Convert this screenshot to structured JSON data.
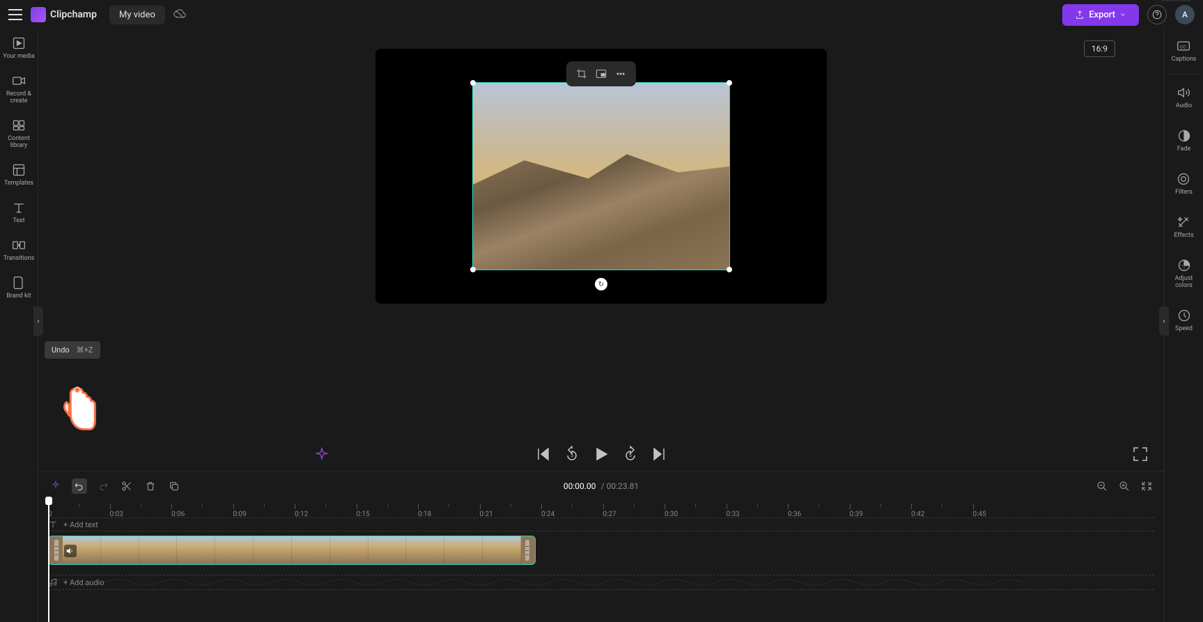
{
  "app": {
    "name": "Clipchamp",
    "project_title": "My video",
    "export_label": "Export",
    "avatar_initial": "A",
    "aspect_ratio": "16:9"
  },
  "left_sidebar": {
    "items": [
      {
        "label": "Your media",
        "icon": "media-icon"
      },
      {
        "label": "Record & create",
        "icon": "record-icon"
      },
      {
        "label": "Content library",
        "icon": "content-icon"
      },
      {
        "label": "Templates",
        "icon": "templates-icon"
      },
      {
        "label": "Text",
        "icon": "text-icon"
      },
      {
        "label": "Transitions",
        "icon": "transitions-icon"
      },
      {
        "label": "Brand kit",
        "icon": "brand-icon"
      }
    ]
  },
  "right_sidebar": {
    "items": [
      {
        "label": "Captions",
        "icon": "captions-icon"
      },
      {
        "label": "Audio",
        "icon": "audio-icon"
      },
      {
        "label": "Fade",
        "icon": "fade-icon"
      },
      {
        "label": "Filters",
        "icon": "filters-icon"
      },
      {
        "label": "Effects",
        "icon": "effects-icon"
      },
      {
        "label": "Adjust colors",
        "icon": "adjust-icon"
      },
      {
        "label": "Speed",
        "icon": "speed-icon"
      }
    ]
  },
  "tooltip": {
    "label": "Undo",
    "shortcut": "⌘+Z"
  },
  "timecode": {
    "current": "00:00.00",
    "separator": "/",
    "total": "00:23.81"
  },
  "ruler": {
    "marks": [
      "0",
      "0:03",
      "0:06",
      "0:09",
      "0:12",
      "0:15",
      "0:18",
      "0:21",
      "0:24",
      "0:27",
      "0:30",
      "0:33",
      "0:36",
      "0:39",
      "0:42",
      "0:45"
    ]
  },
  "tracks": {
    "add_text": "+ Add text",
    "add_audio": "+ Add audio"
  },
  "colors": {
    "accent": "#8338ec",
    "selection": "#2dd4bf"
  }
}
